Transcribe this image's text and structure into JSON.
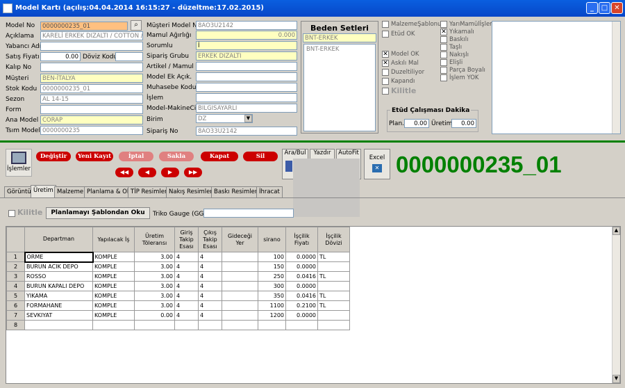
{
  "window": {
    "title": "Model Kartı (açılış:04.04.2014 16:15:27 - düzeltme:17.02.2015)",
    "min": "_",
    "max": "□",
    "close": "✕"
  },
  "left_fields": [
    {
      "label": "Model No",
      "value": "0000000235_01"
    },
    {
      "label": "Açıklama",
      "value": "KARELİ ERKEK DIZALTI / COTTON / C"
    },
    {
      "label": "Yabancı Adı",
      "value": ""
    },
    {
      "label": "Satış Fiyatı",
      "value": "0.00"
    },
    {
      "label": "Kalıp No",
      "value": ""
    },
    {
      "label": "Müşteri",
      "value": "BEN-İTALYA"
    },
    {
      "label": "Stok Kodu",
      "value": "0000000235_01"
    },
    {
      "label": "Sezon",
      "value": "AL 14-15"
    },
    {
      "label": "Form",
      "value": ""
    },
    {
      "label": "Ana Model",
      "value": "CORAP"
    },
    {
      "label": "Tsım Model",
      "value": "0000000235"
    }
  ],
  "doviz_label": "Döviz Kodu",
  "mid_fields": [
    {
      "label": "Müşteri Model No",
      "value": "8AO3U2142"
    },
    {
      "label": "Mamul Ağırlığı",
      "value": "0.000"
    },
    {
      "label": "Sorumlu",
      "value": "İ"
    },
    {
      "label": "Sipariş Grubu",
      "value": "ERKEK DIZALTI"
    },
    {
      "label": "Artikel / Mamul",
      "value": ""
    },
    {
      "label": "Model Ek Açık.",
      "value": ""
    },
    {
      "label": "Muhasebe Kodu",
      "value": ""
    },
    {
      "label": "İşlem",
      "value": ""
    },
    {
      "label": "Model-MakineCins",
      "value": "BILGISAYARLI"
    },
    {
      "label": "Birim",
      "value": "DZ"
    },
    {
      "label": "Sipariş No",
      "value": "8AO33U2142"
    }
  ],
  "beden": {
    "title": "Beden Setleri",
    "selected": "BNT-ERKEK",
    "items": [
      "BNT-ERKEK"
    ]
  },
  "checks_a": [
    {
      "label": "MalzemeŞablonu",
      "checked": false
    },
    {
      "label": "Etüd OK",
      "checked": false
    },
    {
      "label": "Model OK",
      "checked": true
    },
    {
      "label": "Askılı Mal",
      "checked": true
    },
    {
      "label": "Duzeltiliyor",
      "checked": false
    },
    {
      "label": "Kapandı",
      "checked": false
    }
  ],
  "kilitle": "Kilitle",
  "checks_b": [
    {
      "label": "YarıMamülİşlem",
      "checked": false
    },
    {
      "label": "Yıkamalı",
      "checked": true
    },
    {
      "label": "Baskılı",
      "checked": false
    },
    {
      "label": "Taşlı",
      "checked": false
    },
    {
      "label": "Nakışlı",
      "checked": false
    },
    {
      "label": "Elişli",
      "checked": false
    },
    {
      "label": "Parça Boyalı",
      "checked": false
    },
    {
      "label": "İşlem YOK",
      "checked": false
    }
  ],
  "etud": {
    "title": "Etüd Çalışması Dakika",
    "plan_label": "Plan.",
    "plan": "0.00",
    "uretim_label": "Üretim",
    "uretim": "0.00"
  },
  "toolbar": {
    "islemler": "İşlemler",
    "buttons": [
      "Değiştir",
      "Yeni Kayıt",
      "İptal",
      "Sakla",
      "Kapat",
      "Sil"
    ],
    "nav": [
      "◀◀",
      "◀",
      "▶",
      "▶▶"
    ],
    "ara": "Ara/Bul",
    "yazdir": "Yazdır",
    "autofit": "AutoFit",
    "excel": "Excel"
  },
  "big_code": "0000000235_01",
  "tabs": [
    "Görüntü",
    "Üretim",
    "Malzeme",
    "Planlama & Ok",
    "TİP Resimler",
    "Nakış Resimler",
    "Baskı Resimler",
    "İhracat"
  ],
  "sub": {
    "kilitle": "Kilitle",
    "sablon_btn": "Planlamayı Şablondan Oku",
    "triko": "Triko Gauge (GG)"
  },
  "grid": {
    "headers": [
      "Departman",
      "Yapılacak İş",
      "Üretim Töleransı",
      "Giriş Takip Esası",
      "Çıkış Takip Esası",
      "Gideceği Yer",
      "sirano",
      "İşçilik Fiyatı",
      "İşçilik Dövizi"
    ],
    "rows": [
      [
        "1",
        "ORME",
        "KOMPLE",
        "3.00",
        "4",
        "4",
        "",
        "100",
        "0.0000",
        "TL"
      ],
      [
        "2",
        "BURUN ACIK DEPO",
        "KOMPLE",
        "3.00",
        "4",
        "4",
        "",
        "150",
        "0.0000",
        ""
      ],
      [
        "3",
        "ROSSO",
        "KOMPLE",
        "3.00",
        "4",
        "4",
        "",
        "250",
        "0.0416",
        "TL"
      ],
      [
        "4",
        "BURUN KAPALI DEPO",
        "KOMPLE",
        "3.00",
        "4",
        "4",
        "",
        "300",
        "0.0000",
        ""
      ],
      [
        "5",
        "YIKAMA",
        "KOMPLE",
        "3.00",
        "4",
        "4",
        "",
        "350",
        "0.0416",
        "TL"
      ],
      [
        "6",
        "FORMAHANE",
        "KOMPLE",
        "3.00",
        "4",
        "4",
        "",
        "1100",
        "0.2100",
        "TL"
      ],
      [
        "7",
        "SEVKIYAT",
        "KOMPLE",
        "0.00",
        "4",
        "4",
        "",
        "1200",
        "0.0000",
        ""
      ],
      [
        "8",
        "",
        "",
        "",
        "",
        "",
        "",
        "",
        "",
        ""
      ]
    ]
  }
}
